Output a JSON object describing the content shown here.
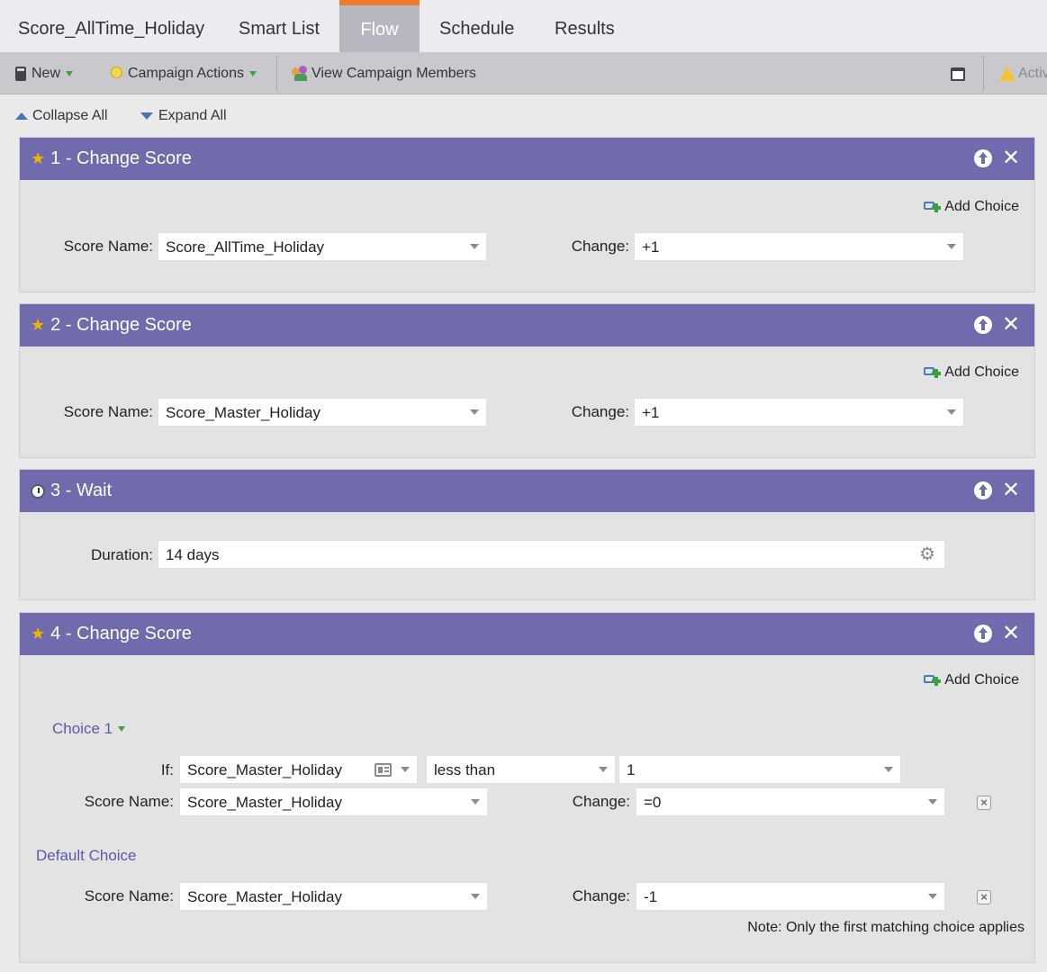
{
  "tabs": [
    {
      "label": "Score_AllTime_Holiday",
      "active": false
    },
    {
      "label": "Smart List",
      "active": false
    },
    {
      "label": "Flow",
      "active": true
    },
    {
      "label": "Schedule",
      "active": false
    },
    {
      "label": "Results",
      "active": false
    }
  ],
  "toolbar": {
    "new_label": "New",
    "campaign_actions_label": "Campaign Actions",
    "view_members_label": "View Campaign Members",
    "activate_label": "Activ"
  },
  "collapse_all": "Collapse All",
  "expand_all": "Expand All",
  "add_choice_label": "Add Choice",
  "steps": [
    {
      "title": "1 - Change Score",
      "score_name_label": "Score Name:",
      "score_name_value": "Score_AllTime_Holiday",
      "change_label": "Change:",
      "change_value": "+1"
    },
    {
      "title": "2 - Change Score",
      "score_name_label": "Score Name:",
      "score_name_value": "Score_Master_Holiday",
      "change_label": "Change:",
      "change_value": "+1"
    },
    {
      "title": "3 - Wait",
      "duration_label": "Duration:",
      "duration_value": "14 days"
    },
    {
      "title": "4 - Change Score",
      "choice1": {
        "title": "Choice 1",
        "if_label": "If:",
        "if_field": "Score_Master_Holiday",
        "if_operator": "less than",
        "if_value": "1",
        "score_name_label": "Score Name:",
        "score_name_value": "Score_Master_Holiday",
        "change_label": "Change:",
        "change_value": "=0"
      },
      "default_choice": {
        "title": "Default Choice",
        "score_name_label": "Score Name:",
        "score_name_value": "Score_Master_Holiday",
        "change_label": "Change:",
        "change_value": "-1"
      },
      "note": "Note: Only the first matching choice applies"
    }
  ],
  "colors": {
    "step_header": "#706bad",
    "active_tab_border": "#ef7b2f",
    "link": "#5a5aa8"
  }
}
